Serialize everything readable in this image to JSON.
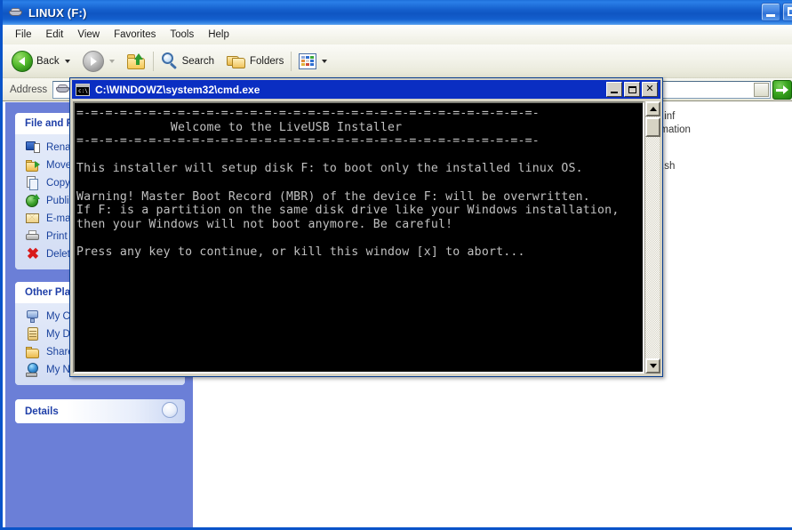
{
  "window": {
    "title": "LINUX (F:)",
    "title_icon": "drive-icon",
    "buttons": {
      "minimize": "minimize-button",
      "maximize": "maximize-button"
    }
  },
  "menubar": {
    "items": [
      {
        "label": "File"
      },
      {
        "label": "Edit"
      },
      {
        "label": "View"
      },
      {
        "label": "Favorites"
      },
      {
        "label": "Tools"
      },
      {
        "label": "Help"
      }
    ]
  },
  "toolbar": {
    "back_label": "Back",
    "search_label": "Search",
    "folders_label": "Folders",
    "icons": {
      "back": "back-arrow-icon",
      "forward": "forward-arrow-icon",
      "up": "up-folder-icon",
      "search": "magnifier-icon",
      "folders": "folders-icon",
      "views": "views-grid-icon"
    }
  },
  "address": {
    "label": "Address",
    "value": "",
    "drive_icon": "drive-icon",
    "dropdown_icon": "chevron-down-icon",
    "go_icon": "go-arrow-icon"
  },
  "sidebar": {
    "panels": [
      {
        "title": "File and Folder Tasks",
        "collapse_icon": "chevron-up-icon",
        "items": [
          {
            "label": "Rename this file",
            "icon": "rename-icon"
          },
          {
            "label": "Move this file",
            "icon": "move-icon"
          },
          {
            "label": "Copy this file",
            "icon": "copy-icon"
          },
          {
            "label": "Publish this file to the Web",
            "icon": "publish-icon"
          },
          {
            "label": "E-mail this file",
            "icon": "email-icon"
          },
          {
            "label": "Print this file",
            "icon": "print-icon"
          },
          {
            "label": "Delete this file",
            "icon": "delete-icon"
          }
        ]
      },
      {
        "title": "Other Places",
        "collapse_icon": "chevron-up-icon",
        "items": [
          {
            "label": "My Computer",
            "icon": "my-computer-icon"
          },
          {
            "label": "My Documents",
            "icon": "my-documents-icon"
          },
          {
            "label": "Shared Documents",
            "icon": "shared-folder-icon"
          },
          {
            "label": "My Network Places",
            "icon": "network-places-icon"
          }
        ]
      },
      {
        "title": "Details",
        "collapse_icon": "chevron-down-icon",
        "items": []
      }
    ]
  },
  "filelist": {
    "entries": [
      {
        "text": ".inf"
      },
      {
        "text": "formation"
      },
      {
        "text": ".sh"
      }
    ]
  },
  "cmd": {
    "title": "C:\\WINDOWZ\\system32\\cmd.exe",
    "icon": "console-icon",
    "buttons": {
      "minimize": "minimize-button",
      "maximize": "maximize-button",
      "close_label": "✕"
    },
    "scrollbar": {
      "up_icon": "scroll-up-arrow-icon",
      "down_icon": "scroll-down-arrow-icon",
      "thumb": "scrollbar-thumb"
    },
    "output": "=-=-=-=-=-=-=-=-=-=-=-=-=-=-=-=-=-=-=-=-=-=-=-=-=-=-=-=-=-=-=-=-\n             Welcome to the LiveUSB Installer\n=-=-=-=-=-=-=-=-=-=-=-=-=-=-=-=-=-=-=-=-=-=-=-=-=-=-=-=-=-=-=-=-\n\nThis installer will setup disk F: to boot only the installed linux OS.\n\nWarning! Master Boot Record (MBR) of the device F: will be overwritten.\nIf F: is a partition on the same disk drive like your Windows installation,\nthen your Windows will not boot anymore. Be careful!\n\nPress any key to continue, or kill this window [x] to abort..."
  },
  "colors": {
    "titlebar_blue": "#0f55c2",
    "sidebar_blue": "#6b7fd7",
    "cmd_title_blue": "#0a2ec2",
    "console_fg": "#c0c0c0",
    "console_bg": "#000000",
    "link_blue": "#18409c"
  }
}
